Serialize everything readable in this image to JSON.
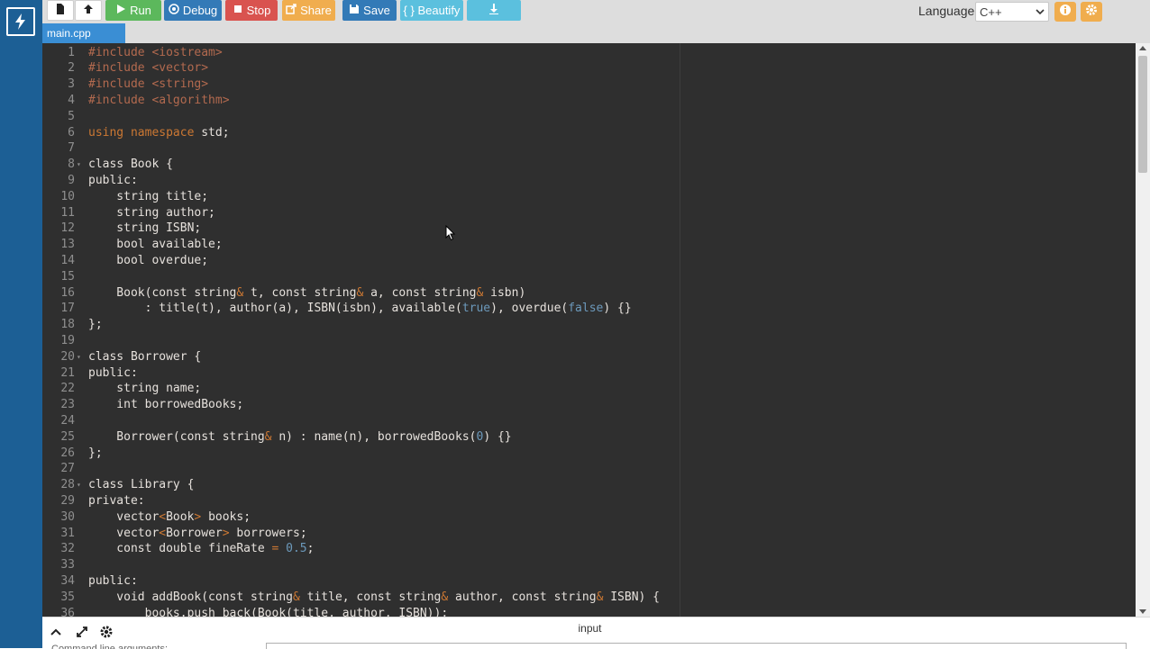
{
  "toolbar": {
    "run_label": "Run",
    "debug_label": "Debug",
    "stop_label": "Stop",
    "share_label": "Share",
    "save_label": "Save",
    "beautify_label": "{ } Beautify",
    "language_label": "Language",
    "language_value": "C++"
  },
  "tab": {
    "filename": "main.cpp"
  },
  "io": {
    "input_label": "input",
    "hint": "Command line arguments:"
  },
  "colors": {
    "run": "#5cb85c",
    "debug": "#337ab7",
    "stop": "#d9534f",
    "share": "#f0ad4e",
    "save": "#337ab7",
    "beautify": "#5bc0de",
    "download": "#5bc0de",
    "sidebar": "#1c5f95",
    "tab": "#3a8ed4",
    "editor_bg": "#2f2f2f"
  },
  "code_lines": [
    {
      "n": "1",
      "fold": "",
      "segs": [
        [
          "pre",
          "#include <iostream>"
        ]
      ]
    },
    {
      "n": "2",
      "fold": "",
      "segs": [
        [
          "pre",
          "#include <vector>"
        ]
      ]
    },
    {
      "n": "3",
      "fold": "",
      "segs": [
        [
          "pre",
          "#include <string>"
        ]
      ]
    },
    {
      "n": "4",
      "fold": "",
      "segs": [
        [
          "pre",
          "#include <algorithm>"
        ]
      ]
    },
    {
      "n": "5",
      "fold": "",
      "segs": []
    },
    {
      "n": "6",
      "fold": "",
      "segs": [
        [
          "kw",
          "using namespace"
        ],
        [
          "plain",
          " std;"
        ]
      ]
    },
    {
      "n": "7",
      "fold": "",
      "segs": []
    },
    {
      "n": "8",
      "fold": "▾",
      "segs": [
        [
          "plain",
          "class Book {"
        ]
      ]
    },
    {
      "n": "9",
      "fold": "",
      "segs": [
        [
          "plain",
          "public:"
        ]
      ]
    },
    {
      "n": "10",
      "fold": "",
      "segs": [
        [
          "plain",
          "    string title;"
        ]
      ]
    },
    {
      "n": "11",
      "fold": "",
      "segs": [
        [
          "plain",
          "    string author;"
        ]
      ]
    },
    {
      "n": "12",
      "fold": "",
      "segs": [
        [
          "plain",
          "    string ISBN;"
        ]
      ]
    },
    {
      "n": "13",
      "fold": "",
      "segs": [
        [
          "plain",
          "    bool available;"
        ]
      ]
    },
    {
      "n": "14",
      "fold": "",
      "segs": [
        [
          "plain",
          "    bool overdue;"
        ]
      ]
    },
    {
      "n": "15",
      "fold": "",
      "segs": []
    },
    {
      "n": "16",
      "fold": "",
      "segs": [
        [
          "plain",
          "    Book(const string"
        ],
        [
          "sym",
          "&"
        ],
        [
          "plain",
          " t, const string"
        ],
        [
          "sym",
          "&"
        ],
        [
          "plain",
          " a, const string"
        ],
        [
          "sym",
          "&"
        ],
        [
          "plain",
          " isbn)"
        ]
      ]
    },
    {
      "n": "17",
      "fold": "",
      "segs": [
        [
          "plain",
          "        : title(t), author(a), ISBN(isbn), available("
        ],
        [
          "num",
          "true"
        ],
        [
          "plain",
          "), overdue("
        ],
        [
          "num",
          "false"
        ],
        [
          "plain",
          ") {}"
        ]
      ]
    },
    {
      "n": "18",
      "fold": "",
      "segs": [
        [
          "plain",
          "};"
        ]
      ]
    },
    {
      "n": "19",
      "fold": "",
      "segs": []
    },
    {
      "n": "20",
      "fold": "▾",
      "segs": [
        [
          "plain",
          "class Borrower {"
        ]
      ]
    },
    {
      "n": "21",
      "fold": "",
      "segs": [
        [
          "plain",
          "public:"
        ]
      ]
    },
    {
      "n": "22",
      "fold": "",
      "segs": [
        [
          "plain",
          "    string name;"
        ]
      ]
    },
    {
      "n": "23",
      "fold": "",
      "segs": [
        [
          "plain",
          "    int borrowedBooks;"
        ]
      ]
    },
    {
      "n": "24",
      "fold": "",
      "segs": []
    },
    {
      "n": "25",
      "fold": "",
      "segs": [
        [
          "plain",
          "    Borrower(const string"
        ],
        [
          "sym",
          "&"
        ],
        [
          "plain",
          " n) : name(n), borrowedBooks("
        ],
        [
          "num",
          "0"
        ],
        [
          "plain",
          ") {}"
        ]
      ]
    },
    {
      "n": "26",
      "fold": "",
      "segs": [
        [
          "plain",
          "};"
        ]
      ]
    },
    {
      "n": "27",
      "fold": "",
      "segs": []
    },
    {
      "n": "28",
      "fold": "▾",
      "segs": [
        [
          "plain",
          "class Library {"
        ]
      ]
    },
    {
      "n": "29",
      "fold": "",
      "segs": [
        [
          "plain",
          "private:"
        ]
      ]
    },
    {
      "n": "30",
      "fold": "",
      "segs": [
        [
          "plain",
          "    vector"
        ],
        [
          "sym",
          "<"
        ],
        [
          "plain",
          "Book"
        ],
        [
          "sym",
          ">"
        ],
        [
          "plain",
          " books;"
        ]
      ]
    },
    {
      "n": "31",
      "fold": "",
      "segs": [
        [
          "plain",
          "    vector"
        ],
        [
          "sym",
          "<"
        ],
        [
          "plain",
          "Borrower"
        ],
        [
          "sym",
          ">"
        ],
        [
          "plain",
          " borrowers;"
        ]
      ]
    },
    {
      "n": "32",
      "fold": "",
      "segs": [
        [
          "plain",
          "    const double fineRate "
        ],
        [
          "sym",
          "="
        ],
        [
          "plain",
          " "
        ],
        [
          "num",
          "0.5"
        ],
        [
          "plain",
          ";"
        ]
      ]
    },
    {
      "n": "33",
      "fold": "",
      "segs": []
    },
    {
      "n": "34",
      "fold": "",
      "segs": [
        [
          "plain",
          "public:"
        ]
      ]
    },
    {
      "n": "35",
      "fold": "",
      "segs": [
        [
          "plain",
          "    void addBook(const string"
        ],
        [
          "sym",
          "&"
        ],
        [
          "plain",
          " title, const string"
        ],
        [
          "sym",
          "&"
        ],
        [
          "plain",
          " author, const string"
        ],
        [
          "sym",
          "&"
        ],
        [
          "plain",
          " ISBN) {"
        ]
      ]
    },
    {
      "n": "36",
      "fold": "",
      "segs": [
        [
          "plain",
          "        books.push_back(Book(title, author, ISBN));"
        ]
      ]
    }
  ]
}
